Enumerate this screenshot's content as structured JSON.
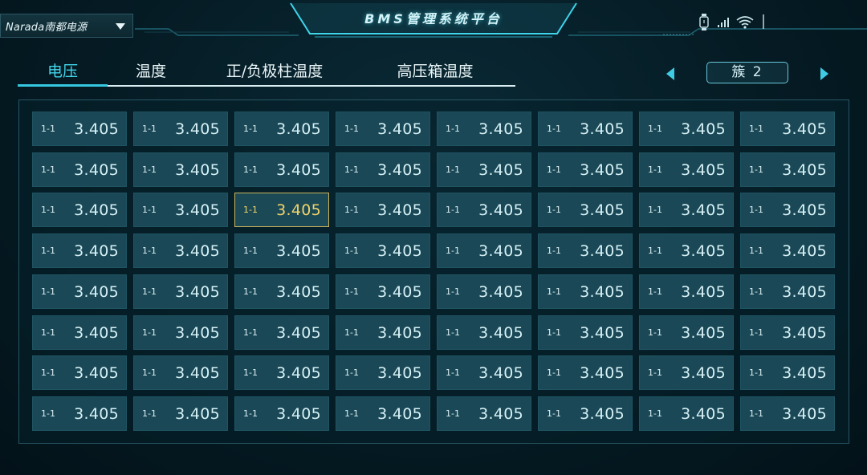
{
  "header": {
    "brand": "Narada南都电源",
    "title": "BMS管理系统平台"
  },
  "tabs": [
    {
      "label": "电压",
      "active": true
    },
    {
      "label": "温度",
      "active": false
    },
    {
      "label": "正/负极柱温度",
      "active": false
    },
    {
      "label": "高压箱温度",
      "active": false
    }
  ],
  "cluster": {
    "label": "簇 2"
  },
  "grid": {
    "rows": 8,
    "cols": 8,
    "selected": {
      "row": 2,
      "col": 2
    },
    "cells": [
      [
        {
          "id": "1-1",
          "value": "3.405"
        },
        {
          "id": "1-1",
          "value": "3.405"
        },
        {
          "id": "1-1",
          "value": "3.405"
        },
        {
          "id": "1-1",
          "value": "3.405"
        },
        {
          "id": "1-1",
          "value": "3.405"
        },
        {
          "id": "1-1",
          "value": "3.405"
        },
        {
          "id": "1-1",
          "value": "3.405"
        },
        {
          "id": "1-1",
          "value": "3.405"
        }
      ],
      [
        {
          "id": "1-1",
          "value": "3.405"
        },
        {
          "id": "1-1",
          "value": "3.405"
        },
        {
          "id": "1-1",
          "value": "3.405"
        },
        {
          "id": "1-1",
          "value": "3.405"
        },
        {
          "id": "1-1",
          "value": "3.405"
        },
        {
          "id": "1-1",
          "value": "3.405"
        },
        {
          "id": "1-1",
          "value": "3.405"
        },
        {
          "id": "1-1",
          "value": "3.405"
        }
      ],
      [
        {
          "id": "1-1",
          "value": "3.405"
        },
        {
          "id": "1-1",
          "value": "3.405"
        },
        {
          "id": "1-1",
          "value": "3.405"
        },
        {
          "id": "1-1",
          "value": "3.405"
        },
        {
          "id": "1-1",
          "value": "3.405"
        },
        {
          "id": "1-1",
          "value": "3.405"
        },
        {
          "id": "1-1",
          "value": "3.405"
        },
        {
          "id": "1-1",
          "value": "3.405"
        }
      ],
      [
        {
          "id": "1-1",
          "value": "3.405"
        },
        {
          "id": "1-1",
          "value": "3.405"
        },
        {
          "id": "1-1",
          "value": "3.405"
        },
        {
          "id": "1-1",
          "value": "3.405"
        },
        {
          "id": "1-1",
          "value": "3.405"
        },
        {
          "id": "1-1",
          "value": "3.405"
        },
        {
          "id": "1-1",
          "value": "3.405"
        },
        {
          "id": "1-1",
          "value": "3.405"
        }
      ],
      [
        {
          "id": "1-1",
          "value": "3.405"
        },
        {
          "id": "1-1",
          "value": "3.405"
        },
        {
          "id": "1-1",
          "value": "3.405"
        },
        {
          "id": "1-1",
          "value": "3.405"
        },
        {
          "id": "1-1",
          "value": "3.405"
        },
        {
          "id": "1-1",
          "value": "3.405"
        },
        {
          "id": "1-1",
          "value": "3.405"
        },
        {
          "id": "1-1",
          "value": "3.405"
        }
      ],
      [
        {
          "id": "1-1",
          "value": "3.405"
        },
        {
          "id": "1-1",
          "value": "3.405"
        },
        {
          "id": "1-1",
          "value": "3.405"
        },
        {
          "id": "1-1",
          "value": "3.405"
        },
        {
          "id": "1-1",
          "value": "3.405"
        },
        {
          "id": "1-1",
          "value": "3.405"
        },
        {
          "id": "1-1",
          "value": "3.405"
        },
        {
          "id": "1-1",
          "value": "3.405"
        }
      ],
      [
        {
          "id": "1-1",
          "value": "3.405"
        },
        {
          "id": "1-1",
          "value": "3.405"
        },
        {
          "id": "1-1",
          "value": "3.405"
        },
        {
          "id": "1-1",
          "value": "3.405"
        },
        {
          "id": "1-1",
          "value": "3.405"
        },
        {
          "id": "1-1",
          "value": "3.405"
        },
        {
          "id": "1-1",
          "value": "3.405"
        },
        {
          "id": "1-1",
          "value": "3.405"
        }
      ],
      [
        {
          "id": "1-1",
          "value": "3.405"
        },
        {
          "id": "1-1",
          "value": "3.405"
        },
        {
          "id": "1-1",
          "value": "3.405"
        },
        {
          "id": "1-1",
          "value": "3.405"
        },
        {
          "id": "1-1",
          "value": "3.405"
        },
        {
          "id": "1-1",
          "value": "3.405"
        },
        {
          "id": "1-1",
          "value": "3.405"
        },
        {
          "id": "1-1",
          "value": "3.405"
        }
      ]
    ]
  },
  "colors": {
    "accent": "#41d6ea",
    "selected_border": "#c9b25d",
    "selected_text": "#f2d36a",
    "cell_bg": "#1a4856"
  },
  "icons": {
    "device": "watch-icon",
    "signal": "signal-bars-icon",
    "wifi": "wifi-icon",
    "menu": "brand-dropdown-icon",
    "prev": "prev-arrow-icon",
    "next": "next-arrow-icon"
  }
}
